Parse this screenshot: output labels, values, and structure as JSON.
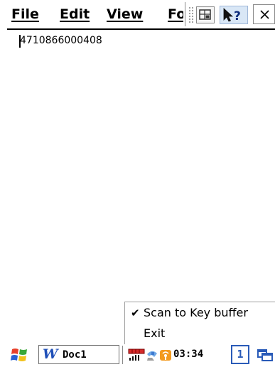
{
  "menubar": {
    "file": "File",
    "edit": "Edit",
    "view": "View",
    "format_truncated": "Format"
  },
  "document": {
    "text": "4710866000408"
  },
  "popup_menu": {
    "items": [
      {
        "label": "Scan to Key buffer",
        "checked": true,
        "check_glyph": "✔"
      },
      {
        "label": "Exit",
        "checked": false
      }
    ]
  },
  "taskbar": {
    "start_icon": "windows-flag-icon",
    "task": {
      "icon_glyph": "W",
      "label": "Doc1"
    },
    "clock": "03:34",
    "input_indicator": "1"
  },
  "colors": {
    "flag_red": "#e8402a",
    "flag_green": "#3aa83a",
    "flag_blue": "#2a62d4",
    "flag_yellow": "#f2c21b",
    "accent_blue": "#2a5bb8"
  }
}
